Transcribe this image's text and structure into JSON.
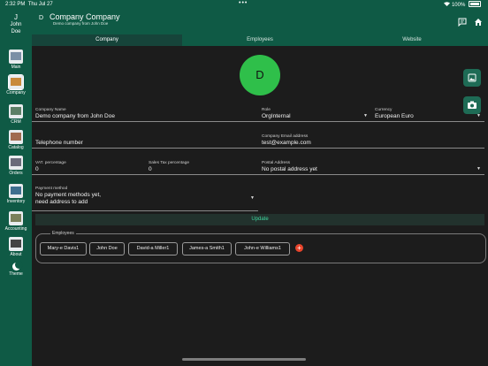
{
  "status_bar": {
    "time": "2:32 PM",
    "date": "Thu Jul 27",
    "battery": "100%",
    "dots": "•••"
  },
  "sidebar": {
    "user": {
      "initial": "J",
      "name_line1": "John",
      "name_line2": "Doe"
    },
    "items": [
      {
        "label": "Main",
        "icon": "main-icon"
      },
      {
        "label": "Company",
        "icon": "company-icon",
        "active": true
      },
      {
        "label": "CRM",
        "icon": "crm-icon"
      },
      {
        "label": "Catalog",
        "icon": "catalog-icon"
      },
      {
        "label": "Orders",
        "icon": "orders-icon"
      },
      {
        "label": "Inventory",
        "icon": "inventory-icon"
      },
      {
        "label": "Accounting",
        "icon": "accounting-icon"
      },
      {
        "label": "About",
        "icon": "about-icon"
      }
    ],
    "theme_label": "Theme"
  },
  "header": {
    "avatar_initial": "D",
    "title": "Company Company",
    "subtitle": "Demo company from John Doe"
  },
  "tabs": [
    {
      "label": "Company",
      "active": true
    },
    {
      "label": "Employees"
    },
    {
      "label": "Website"
    }
  ],
  "company_avatar": "D",
  "form": {
    "company_name": {
      "label": "Company Name",
      "value": "Demo company from John Doe"
    },
    "role": {
      "label": "Role",
      "value": "OrgInternal"
    },
    "currency": {
      "label": "Currency",
      "value": "European Euro"
    },
    "telephone": {
      "label": "",
      "value": "Telephone number"
    },
    "email": {
      "label": "Company Email address",
      "value": "test@example.com"
    },
    "vat": {
      "label": "VAT. percentage",
      "value": "0"
    },
    "sales_tax": {
      "label": "Sales Tax percentage",
      "value": "0"
    },
    "postal": {
      "label": "Postal Address",
      "value": "No postal address yet"
    },
    "payment": {
      "label": "Payment method",
      "value_line1": "No payment methods yet,",
      "value_line2": "need address to add"
    }
  },
  "update_label": "Update",
  "employees": {
    "legend": "Employees",
    "chips": [
      "Mary-e Davis1",
      "John Doe",
      "David-a Miller1",
      "James-a Smith1",
      "John-e Williams1"
    ],
    "add_symbol": "+"
  },
  "colors": {
    "brand_green": "#0f5a45",
    "accent_teal": "#3fd8a0",
    "avatar_green": "#2fbf4a",
    "add_red": "#e8442b"
  }
}
